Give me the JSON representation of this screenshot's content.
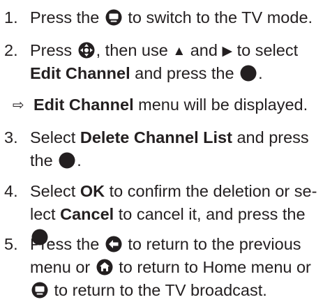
{
  "steps": [
    {
      "number": "1.",
      "lines": [
        [
          "Press the ",
          "icon:tv-mode",
          " to switch to the TV mode."
        ]
      ]
    },
    {
      "number": "2.",
      "lines": [
        [
          "Press ",
          "icon:options",
          ", then use ",
          "icon:up",
          " and ",
          "icon:right",
          " to select"
        ],
        [
          "bold:Edit Channel",
          " and press the ",
          "icon:ok"
        ]
      ]
    },
    {
      "number": "3.",
      "lines": [
        [
          "Select ",
          "bold:Delete Channel List",
          " and press"
        ],
        [
          "the ",
          "icon:ok",
          "."
        ]
      ]
    },
    {
      "number": "4.",
      "lines": [
        [
          "Select ",
          "bold:OK",
          " to confirm the deletion or se-"
        ],
        [
          "lect ",
          "bold:Cancel",
          " to cancel it, and press the"
        ],
        [
          "icon:ok",
          "."
        ]
      ]
    },
    {
      "number": "5.",
      "lines": [
        [
          "Press the ",
          "icon:back",
          " to return to the previous"
        ],
        [
          "menu or ",
          "icon:home",
          " to return to Home menu or"
        ],
        [
          "icon:tv-mode",
          " to return to the TV broadcast."
        ]
      ]
    }
  ],
  "result_text": {
    "mark": "⇨",
    "bold": "Edit Channel",
    "rest": " menu will be displayed."
  },
  "icons": {
    "tv-mode": "tv-button-icon",
    "options": "options-dpad-icon",
    "up": "up-triangle-icon",
    "right": "right-triangle-icon",
    "ok": "ok-button-icon",
    "back": "back-arrow-icon",
    "home": "home-icon"
  },
  "colors": {
    "text": "#231f20",
    "icon": "#231f20"
  }
}
